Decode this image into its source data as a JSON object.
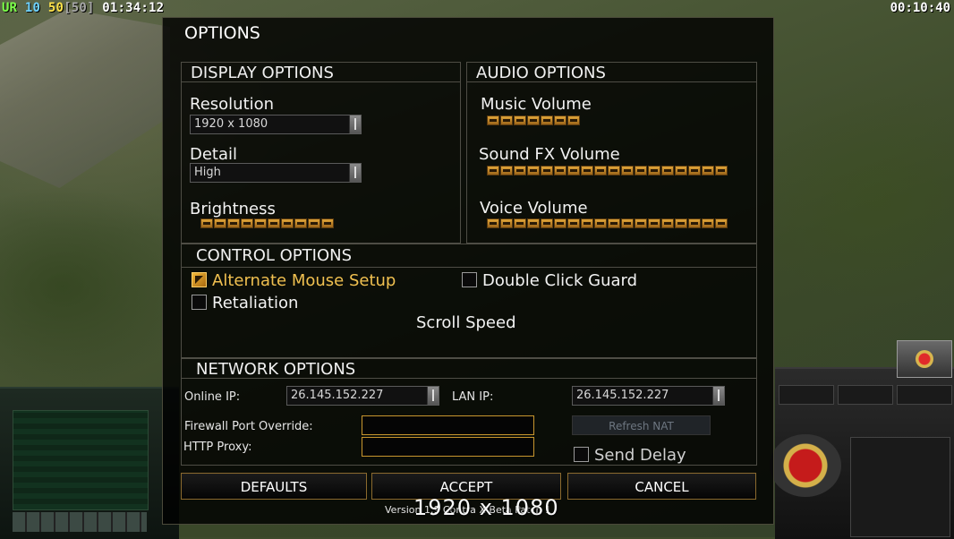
{
  "hud": {
    "stats": {
      "label": "UR",
      "a": "10",
      "b": "50",
      "c": "[50]",
      "time": "01:34:12"
    },
    "clock": "00:10:40"
  },
  "options": {
    "title": "OPTIONS",
    "display": {
      "heading": "DISPLAY OPTIONS",
      "resolution_label": "Resolution",
      "resolution_value": "1920 x 1080",
      "detail_label": "Detail",
      "detail_value": "High",
      "brightness_label": "Brightness",
      "brightness_level": 10
    },
    "audio": {
      "heading": "AUDIO OPTIONS",
      "music_label": "Music Volume",
      "music_level": 7,
      "sfx_label": "Sound FX Volume",
      "sfx_level": 18,
      "voice_label": "Voice Volume",
      "voice_level": 18
    },
    "control": {
      "heading": "CONTROL OPTIONS",
      "alternate_mouse_label": "Alternate Mouse Setup",
      "alternate_mouse_checked": true,
      "double_click_label": "Double Click Guard",
      "double_click_checked": false,
      "retaliation_label": "Retaliation",
      "retaliation_checked": false,
      "scroll_speed_label": "Scroll Speed"
    },
    "network": {
      "heading": "NETWORK OPTIONS",
      "online_ip_label": "Online IP:",
      "online_ip_value": "26.145.152.227",
      "lan_ip_label": "LAN IP:",
      "lan_ip_value": "26.145.152.227",
      "firewall_label": "Firewall Port Override:",
      "firewall_value": "",
      "http_proxy_label": "HTTP Proxy:",
      "http_proxy_value": "",
      "refresh_nat_label": "Refresh NAT",
      "send_delay_label": "Send Delay",
      "send_delay_checked": false
    },
    "buttons": {
      "defaults": "DEFAULTS",
      "accept": "ACCEPT",
      "cancel": "CANCEL"
    },
    "version": "Version 1.9 Contra X Beta Patch 1",
    "resolution_overlay": "1920 x 1080"
  }
}
